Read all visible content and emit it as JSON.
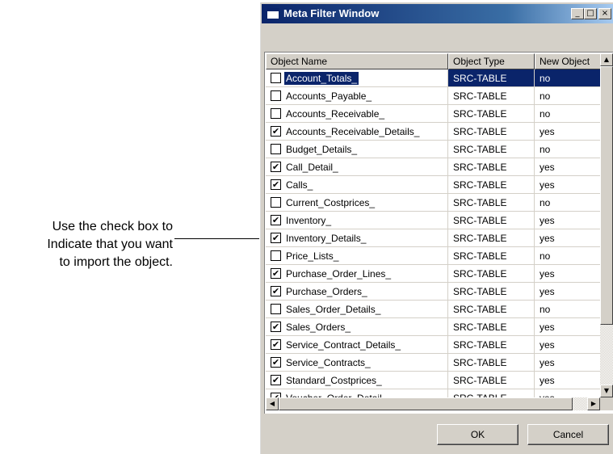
{
  "callout": {
    "line1": "Use the check box to",
    "line2": "Indicate that you want",
    "line3": "to import the object."
  },
  "window": {
    "title": "Meta Filter Window",
    "minimize_glyph": "_",
    "maximize_glyph": "□",
    "close_glyph": "×"
  },
  "columns": {
    "name": "Object Name",
    "type": "Object Type",
    "new_object": "New Object"
  },
  "rows": [
    {
      "name": "Account_Totals_",
      "type": "SRC-TABLE",
      "new": "no",
      "checked": false,
      "selected": true
    },
    {
      "name": "Accounts_Payable_",
      "type": "SRC-TABLE",
      "new": "no",
      "checked": false
    },
    {
      "name": "Accounts_Receivable_",
      "type": "SRC-TABLE",
      "new": "no",
      "checked": false
    },
    {
      "name": "Accounts_Receivable_Details_",
      "type": "SRC-TABLE",
      "new": "yes",
      "checked": true
    },
    {
      "name": "Budget_Details_",
      "type": "SRC-TABLE",
      "new": "no",
      "checked": false
    },
    {
      "name": "Call_Detail_",
      "type": "SRC-TABLE",
      "new": "yes",
      "checked": true
    },
    {
      "name": "Calls_",
      "type": "SRC-TABLE",
      "new": "yes",
      "checked": true
    },
    {
      "name": "Current_Costprices_",
      "type": "SRC-TABLE",
      "new": "no",
      "checked": false
    },
    {
      "name": "Inventory_",
      "type": "SRC-TABLE",
      "new": "yes",
      "checked": true
    },
    {
      "name": "Inventory_Details_",
      "type": "SRC-TABLE",
      "new": "yes",
      "checked": true
    },
    {
      "name": "Price_Lists_",
      "type": "SRC-TABLE",
      "new": "no",
      "checked": false
    },
    {
      "name": "Purchase_Order_Lines_",
      "type": "SRC-TABLE",
      "new": "yes",
      "checked": true
    },
    {
      "name": "Purchase_Orders_",
      "type": "SRC-TABLE",
      "new": "yes",
      "checked": true
    },
    {
      "name": "Sales_Order_Details_",
      "type": "SRC-TABLE",
      "new": "no",
      "checked": false
    },
    {
      "name": "Sales_Orders_",
      "type": "SRC-TABLE",
      "new": "yes",
      "checked": true
    },
    {
      "name": "Service_Contract_Details_",
      "type": "SRC-TABLE",
      "new": "yes",
      "checked": true
    },
    {
      "name": "Service_Contracts_",
      "type": "SRC-TABLE",
      "new": "yes",
      "checked": true
    },
    {
      "name": "Standard_Costprices_",
      "type": "SRC-TABLE",
      "new": "yes",
      "checked": true
    },
    {
      "name": "Voucher_Order_Detail",
      "type": "SRC-TABLE",
      "new": "yes",
      "checked": true
    }
  ],
  "buttons": {
    "ok": "OK",
    "cancel": "Cancel"
  },
  "glyphs": {
    "check": "✔",
    "up_arrow": "▲",
    "down_arrow": "▼",
    "left_arrow": "◀",
    "right_arrow": "▶"
  },
  "colors": {
    "title_bar": "#0a246a",
    "selection": "#0a246a",
    "face": "#d4d0c8"
  }
}
